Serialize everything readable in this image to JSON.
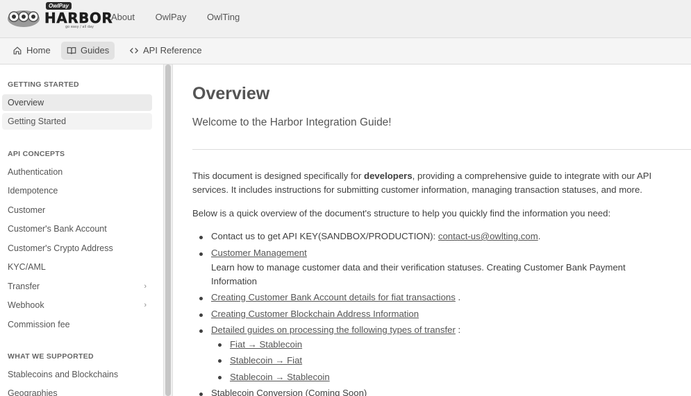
{
  "topbar": {
    "logo_brand": "OwlPay",
    "logo_word": "HARBOR",
    "logo_tag": "go easy / all day",
    "nav": [
      "About",
      "OwlPay",
      "OwlTing"
    ]
  },
  "subtabs": {
    "home": "Home",
    "guides": "Guides",
    "api": "API Reference"
  },
  "sidebar": {
    "sections": [
      {
        "title": "GETTING STARTED",
        "items": [
          "Overview",
          "Getting Started"
        ]
      },
      {
        "title": "API CONCEPTS",
        "items": [
          "Authentication",
          "Idempotence",
          "Customer",
          "Customer's Bank Account",
          "Customer's Crypto Address",
          "KYC/AML",
          "Transfer",
          "Webhook",
          "Commission fee"
        ]
      },
      {
        "title": "WHAT WE SUPPORTED",
        "items": [
          "Stablecoins and Blockchains",
          "Geographies"
        ]
      }
    ]
  },
  "main": {
    "title": "Overview",
    "subtitle": "Welcome to the Harbor Integration Guide!",
    "para1_a": "This document is designed specifically for ",
    "para1_bold": "developers",
    "para1_b": ", providing a comprehensive guide to integrate with our API",
    "para1_line2": "services. It includes instructions for submitting customer information, managing transaction statuses, and more.",
    "para2": "Below is a quick overview of the document's structure to help you quickly find the information you need:",
    "bullet1_text": "Contact us to get API KEY(SANDBOX/PRODUCTION): ",
    "bullet1_link": "contact-us@owlting.com",
    "bullet1_end": ".",
    "bullet2_link": "Customer Management",
    "bullet2_desc1": "Learn how to manage customer data and their verification statuses. Creating Customer Bank Payment",
    "bullet2_desc2": "Information",
    "bullet3_link": "Creating Customer Bank Account details for fiat transactions",
    "bullet3_end": " .",
    "bullet4_link": "Creating Customer Blockchain Address Information",
    "bullet5_link": "Detailed guides on processing the following types of transfer",
    "bullet5_end": " :",
    "sub1": "Fiat → Stablecoin",
    "sub2": "Stablecoin → Fiat",
    "sub3": "Stablecoin → Stablecoin",
    "bullet6": "Stablecoin Conversion (Coming Soon)"
  }
}
